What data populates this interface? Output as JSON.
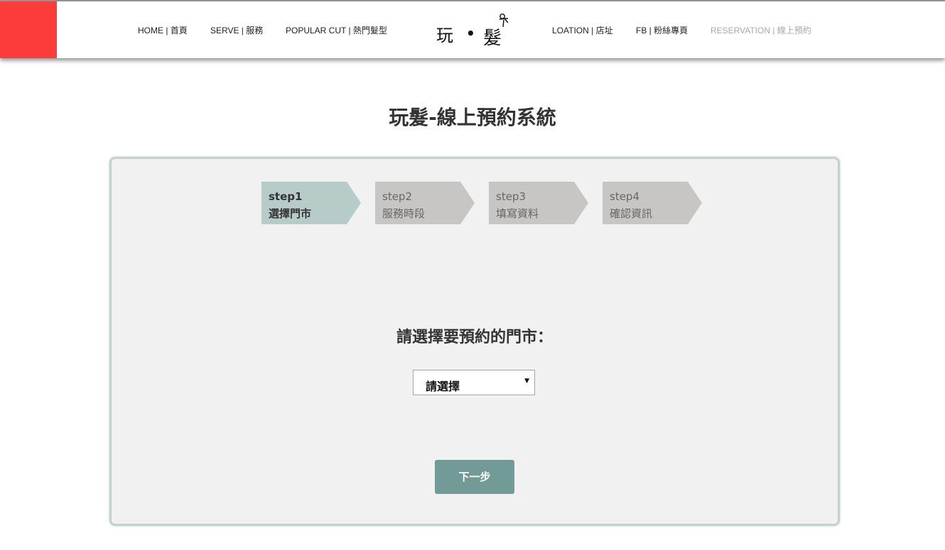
{
  "nav": {
    "home": "HOME | 首頁",
    "serve": "SERVE | 服務",
    "popular": "POPULAR CUT | 熱門髮型",
    "location": "LOATION | 店址",
    "fb": "FB | 粉絲專頁",
    "reservation": "RESERVATION | 線上預約"
  },
  "logo": {
    "text_left": "玩",
    "text_dot": "•",
    "text_right": "髮"
  },
  "page": {
    "title": "玩髮-線上預約系統"
  },
  "steps": [
    {
      "num": "step1",
      "label": "選擇門市",
      "active": true
    },
    {
      "num": "step2",
      "label": "服務時段",
      "active": false
    },
    {
      "num": "step3",
      "label": "填寫資料",
      "active": false
    },
    {
      "num": "step4",
      "label": "確認資訊",
      "active": false
    }
  ],
  "form": {
    "question": "請選擇要預約的門市：",
    "store_select": {
      "value": "請選擇"
    },
    "next_label": "下一步"
  },
  "colors": {
    "brand_red": "#fc3b3b",
    "step_active": "#b7cbc8",
    "step_inactive": "#c8c6c4",
    "button": "#729b97",
    "panel_border": "#c3d2cd"
  }
}
